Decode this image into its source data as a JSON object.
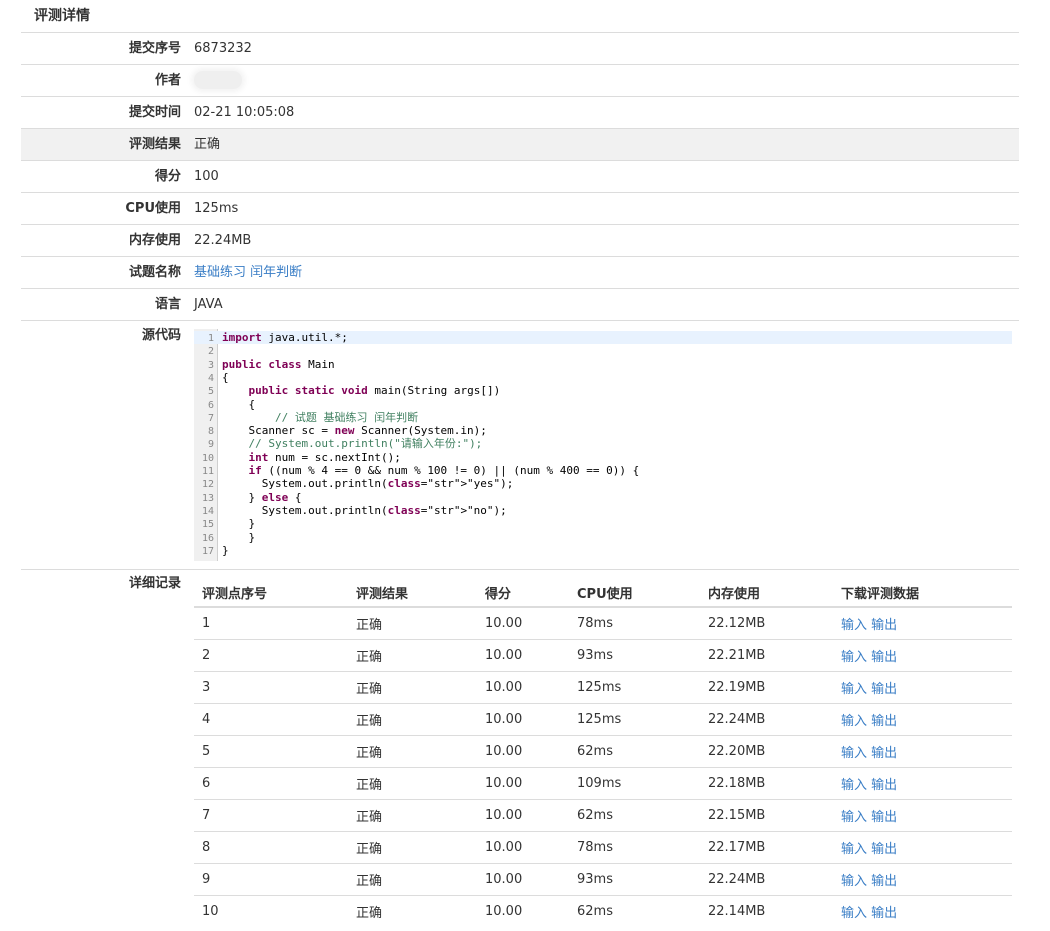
{
  "page_title": "评测详情",
  "info": {
    "submission_id_label": "提交序号",
    "submission_id": "6873232",
    "author_label": "作者",
    "submit_time_label": "提交时间",
    "submit_time": "02-21 10:05:08",
    "result_label": "评测结果",
    "result": "正确",
    "score_label": "得分",
    "score": "100",
    "cpu_label": "CPU使用",
    "cpu": "125ms",
    "memory_label": "内存使用",
    "memory": "22.24MB",
    "problem_label": "试题名称",
    "problem": "基础练习 闰年判断",
    "language_label": "语言",
    "language": "JAVA",
    "source_label": "源代码",
    "detail_label": "详细记录"
  },
  "source_code": [
    "import java.util.*;",
    "",
    "public class Main",
    "{",
    "    public static void main(String args[])",
    "    {",
    "        // 试题 基础练习 闰年判断",
    "    Scanner sc = new Scanner(System.in);",
    "    // System.out.println(\"请输入年份:\");",
    "    int num = sc.nextInt();",
    "    if ((num % 4 == 0 && num % 100 != 0) || (num % 400 == 0)) {",
    "      System.out.println(\"yes\");",
    "    } else {",
    "      System.out.println(\"no\");",
    "    }",
    "    }",
    "}"
  ],
  "results_table": {
    "headers": [
      "评测点序号",
      "评测结果",
      "得分",
      "CPU使用",
      "内存使用",
      "下载评测数据"
    ],
    "input_label": "输入",
    "output_label": "输出",
    "rows": [
      {
        "id": "1",
        "result": "正确",
        "score": "10.00",
        "cpu": "78ms",
        "memory": "22.12MB"
      },
      {
        "id": "2",
        "result": "正确",
        "score": "10.00",
        "cpu": "93ms",
        "memory": "22.21MB"
      },
      {
        "id": "3",
        "result": "正确",
        "score": "10.00",
        "cpu": "125ms",
        "memory": "22.19MB"
      },
      {
        "id": "4",
        "result": "正确",
        "score": "10.00",
        "cpu": "125ms",
        "memory": "22.24MB"
      },
      {
        "id": "5",
        "result": "正确",
        "score": "10.00",
        "cpu": "62ms",
        "memory": "22.20MB"
      },
      {
        "id": "6",
        "result": "正确",
        "score": "10.00",
        "cpu": "109ms",
        "memory": "22.18MB"
      },
      {
        "id": "7",
        "result": "正确",
        "score": "10.00",
        "cpu": "62ms",
        "memory": "22.15MB"
      },
      {
        "id": "8",
        "result": "正确",
        "score": "10.00",
        "cpu": "78ms",
        "memory": "22.17MB"
      },
      {
        "id": "9",
        "result": "正确",
        "score": "10.00",
        "cpu": "93ms",
        "memory": "22.24MB"
      },
      {
        "id": "10",
        "result": "正确",
        "score": "10.00",
        "cpu": "62ms",
        "memory": "22.14MB"
      }
    ]
  },
  "colors": {
    "link": "#3a7ec6",
    "highlight_row": "#f1f1f1",
    "keyword": "#7f0055",
    "comment": "#3f7f5f",
    "string": "#2a00ff"
  }
}
